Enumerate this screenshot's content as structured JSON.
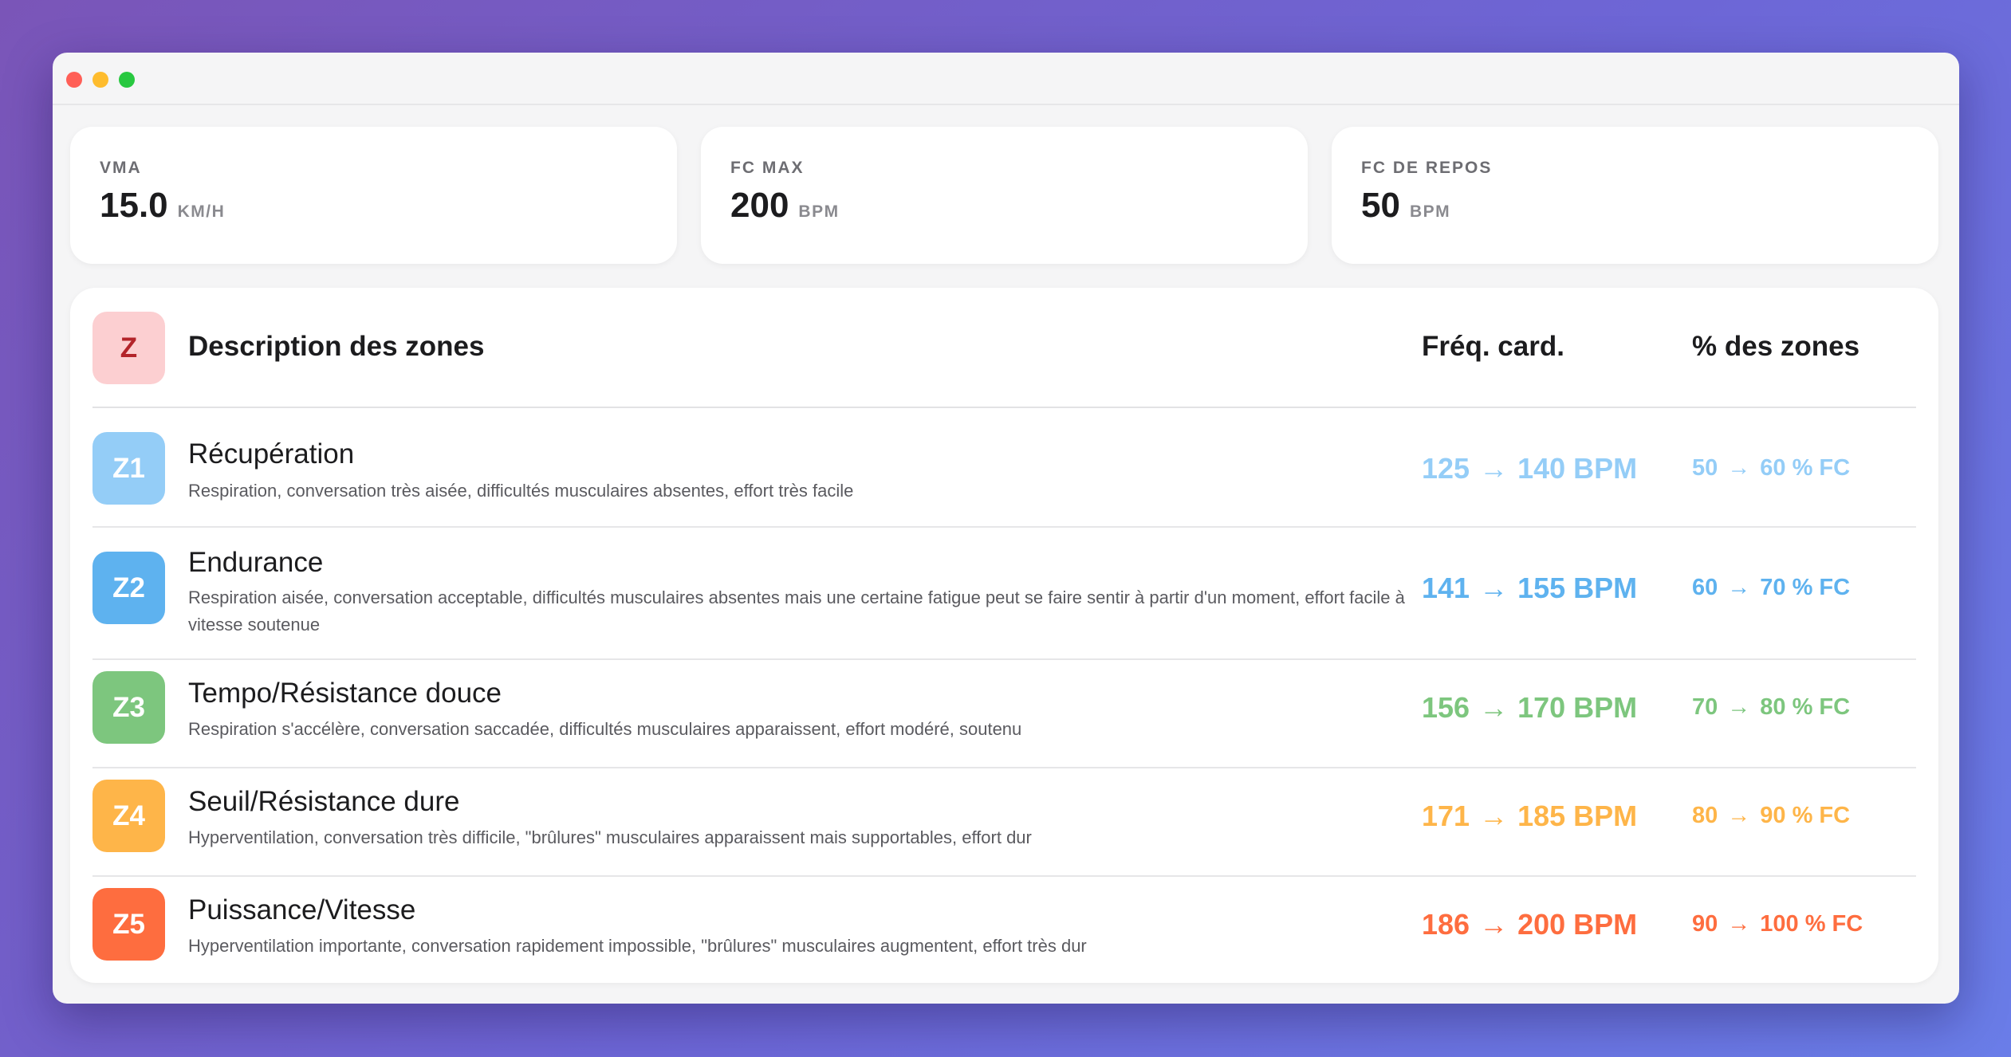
{
  "window": {
    "controls": [
      {
        "name": "close",
        "color": "#ff5f57"
      },
      {
        "name": "minimize",
        "color": "#febc2e"
      },
      {
        "name": "zoom",
        "color": "#28c840"
      }
    ]
  },
  "stats": [
    {
      "label": "VMA",
      "value": "15.0",
      "unit": "KM/H"
    },
    {
      "label": "FC MAX",
      "value": "200",
      "unit": "BPM"
    },
    {
      "label": "FC DE REPOS",
      "value": "50",
      "unit": "BPM"
    }
  ],
  "zones_table": {
    "header": {
      "badge": "Z",
      "badge_bg": "#fccfd1",
      "title": "Description des zones",
      "col_hr": "Fréq. card.",
      "col_pct": "% des zones"
    },
    "arrow": "→",
    "zones": [
      {
        "badge": "Z1",
        "color": "#94cdf7",
        "name": "Récupération",
        "description": "Respiration, conversation très aisée, difficultés musculaires absentes, effort très facile",
        "hr_min": "125",
        "hr_max": "140 BPM",
        "pct_min": "50",
        "pct_max": "60 % FC"
      },
      {
        "badge": "Z2",
        "color": "#5eb2ef",
        "name": "Endurance",
        "description": "Respiration aisée, conversation acceptable, difficultés musculaires absentes mais une certaine fatigue peut se faire sentir à partir d'un moment, effort facile à vitesse soutenue",
        "hr_min": "141",
        "hr_max": "155 BPM",
        "pct_min": "60",
        "pct_max": "70 % FC"
      },
      {
        "badge": "Z3",
        "color": "#7dc67e",
        "name": "Tempo/Résistance douce",
        "description": "Respiration s'accélère, conversation saccadée, difficultés musculaires apparaissent, effort modéré, soutenu",
        "hr_min": "156",
        "hr_max": "170 BPM",
        "pct_min": "70",
        "pct_max": "80 % FC"
      },
      {
        "badge": "Z4",
        "color": "#feb549",
        "name": "Seuil/Résistance dure",
        "description": "Hyperventilation, conversation très difficile, \"brûlures\" musculaires apparaissent mais supportables, effort dur",
        "hr_min": "171",
        "hr_max": "185 BPM",
        "pct_min": "80",
        "pct_max": "90 % FC"
      },
      {
        "badge": "Z5",
        "color": "#fe6d3f",
        "name": "Puissance/Vitesse",
        "description": "Hyperventilation importante, conversation rapidement impossible, \"brûlures\" musculaires augmentent, effort très dur",
        "hr_min": "186",
        "hr_max": "200 BPM",
        "pct_min": "90",
        "pct_max": "100 % FC"
      }
    ]
  }
}
